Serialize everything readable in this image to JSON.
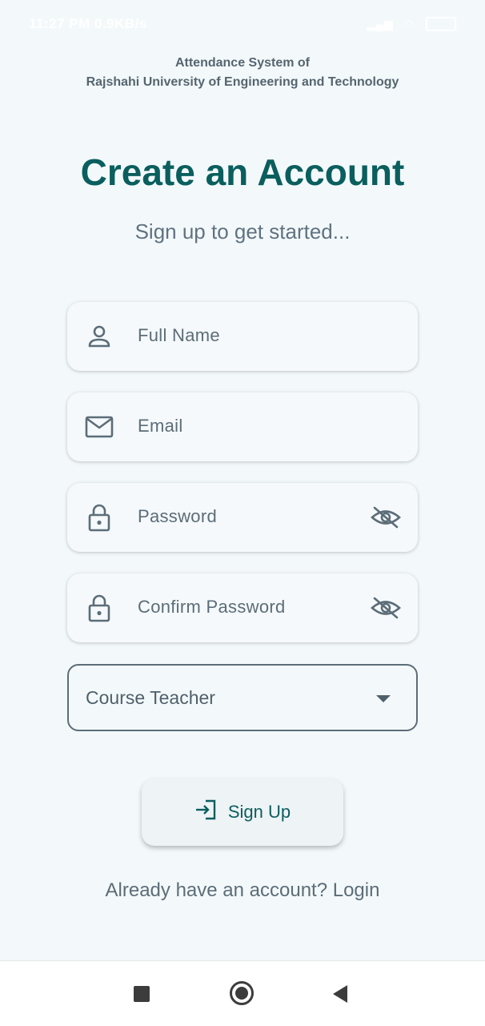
{
  "status_bar": {
    "time": "11:27 PM",
    "speed": "0.9KB/s"
  },
  "header": {
    "line1": "Attendance System of",
    "line2": "Rajshahi University of Engineering and Technology"
  },
  "title": "Create an Account",
  "subtitle": "Sign up to get started...",
  "form": {
    "full_name": {
      "placeholder": "Full Name",
      "icon": "person-icon"
    },
    "email": {
      "placeholder": "Email",
      "icon": "mail-icon"
    },
    "password": {
      "placeholder": "Password",
      "icon": "lock-icon",
      "toggle_icon": "eye-off-icon"
    },
    "confirm_password": {
      "placeholder": "Confirm Password",
      "icon": "lock-icon",
      "toggle_icon": "eye-off-icon"
    },
    "role": {
      "selected": "Course Teacher"
    }
  },
  "signup_button": {
    "label": "Sign Up",
    "icon": "login-icon"
  },
  "login_link": "Already have an account? Login",
  "colors": {
    "background": "#f3f9fb",
    "primary": "#0b5e5e",
    "text": "#55656f"
  }
}
